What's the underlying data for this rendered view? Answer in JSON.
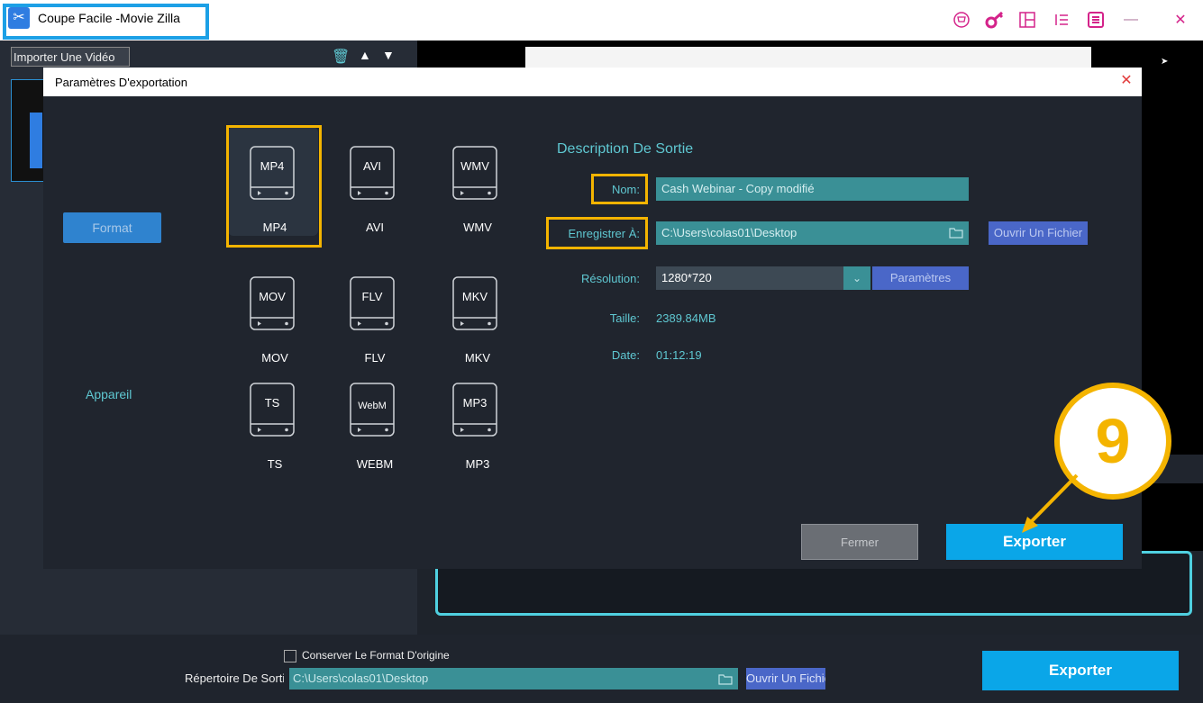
{
  "app": {
    "title": "Coupe Facile -Movie Zilla"
  },
  "toolbar": {
    "import_label": "Importer Une Vidéo"
  },
  "dialog": {
    "title": "Paramètres D'exportation",
    "tabs": {
      "format": "Format",
      "device": "Appareil"
    },
    "formats": [
      {
        "icon_text": "MP4",
        "name": "MP4",
        "selected": true
      },
      {
        "icon_text": "AVI",
        "name": "AVI"
      },
      {
        "icon_text": "WMV",
        "name": "WMV"
      },
      {
        "icon_text": "MOV",
        "name": "MOV"
      },
      {
        "icon_text": "FLV",
        "name": "FLV"
      },
      {
        "icon_text": "MKV",
        "name": "MKV"
      },
      {
        "icon_text": "TS",
        "name": "TS"
      },
      {
        "icon_text": "WebM",
        "name": "WEBM"
      },
      {
        "icon_text": "MP3",
        "name": "MP3"
      }
    ],
    "output": {
      "heading": "Description De Sortie",
      "name_label": "Nom:",
      "name_value": "Cash Webinar - Copy modifié",
      "save_label": "Enregistrer À:",
      "save_value": "C:\\Users\\colas01\\Desktop",
      "open_file_label": "Ouvrir Un Fichier",
      "resolution_label": "Résolution:",
      "resolution_value": "1280*720",
      "settings_label": "Paramètres",
      "size_label": "Taille:",
      "size_value": "2389.84MB",
      "date_label": "Date:",
      "date_value": "01:12:19"
    },
    "close_label": "Fermer",
    "export_label": "Exporter"
  },
  "annotation": {
    "step_number": "9"
  },
  "bottom": {
    "keep_format_label": "Conserver Le Format D'origine",
    "dir_label": "Répertoire De Sortie:",
    "dir_value": "C:\\Users\\colas01\\Desktop",
    "open_file_label": "Ouvrir Un Fichier",
    "export_label": "Exporter"
  },
  "colors": {
    "accent": "#0aa6e8",
    "highlight": "#f4b400",
    "teal": "#3a9096",
    "label": "#5fc8d2"
  }
}
